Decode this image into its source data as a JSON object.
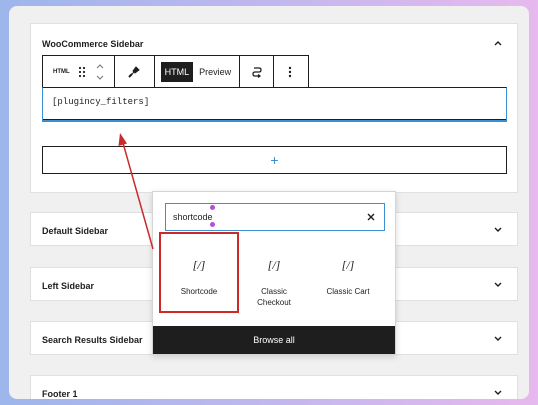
{
  "panels": {
    "woocommerce": {
      "title": "WooCommerce Sidebar",
      "chevron": "chevron-up-icon"
    },
    "default": {
      "title": "Default Sidebar",
      "chevron": "chevron-down-icon"
    },
    "left": {
      "title": "Left Sidebar",
      "chevron": "chevron-down-icon"
    },
    "search": {
      "title": "Search Results Sidebar",
      "chevron": "chevron-down-icon"
    },
    "footer": {
      "title": "Footer 1",
      "chevron": "chevron-down-icon"
    }
  },
  "toolbar": {
    "block_type": "HTML",
    "html_tab": "HTML",
    "preview_tab": "Preview"
  },
  "code_block": {
    "value": "[plugincy_filters]"
  },
  "add_block": {
    "symbol": "+"
  },
  "inserter": {
    "search_value": "shortcode",
    "blocks": [
      {
        "icon": "[/]",
        "label": "Shortcode"
      },
      {
        "icon": "[/]",
        "label": "Classic Checkout"
      },
      {
        "icon": "[/]",
        "label": "Classic Cart"
      }
    ],
    "browse_all": "Browse all"
  },
  "colors": {
    "accent": "#3d8fd1",
    "highlight": "#cc2a2a",
    "dark": "#1e1e1e"
  }
}
